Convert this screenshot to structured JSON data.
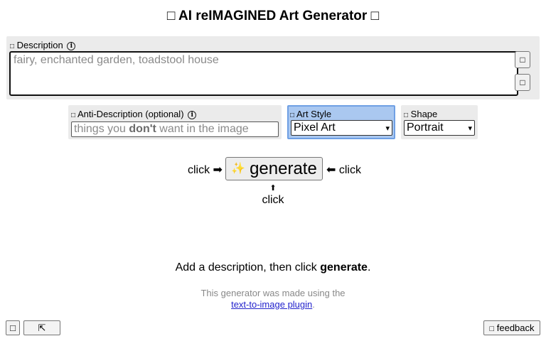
{
  "header": {
    "left_icon": "□",
    "title": "AI reIMAGINED Art Generator",
    "right_icon": "□"
  },
  "description": {
    "label_icon": "□",
    "label": "Description",
    "info_icon": "ⓘ",
    "placeholder": "fairy, enchanted garden, toadstool house",
    "value": "",
    "side_buttons": [
      "□",
      "□"
    ]
  },
  "anti_description": {
    "label_icon": "□",
    "label": "Anti-Description (optional)",
    "info_icon": "ⓘ",
    "placeholder_pre": "things you ",
    "placeholder_bold": "don't",
    "placeholder_post": " want in the image"
  },
  "art_style": {
    "label_icon": "□",
    "label": "Art Style",
    "selected": "Pixel Art"
  },
  "shape": {
    "label_icon": "□",
    "label": "Shape",
    "selected": "Portrait"
  },
  "generate": {
    "icon": "✨",
    "label": "generate",
    "left_hint": "click ➡",
    "right_hint": "⬅ click",
    "bottom_arrow": "⬆",
    "bottom_hint": "click"
  },
  "hint": {
    "pre": "Add a description, then click ",
    "bold": "generate",
    "post": "."
  },
  "credit": {
    "line1": "This generator was made using the",
    "link": "text-to-image plugin",
    "post": "."
  },
  "footer": {
    "left_button": "□",
    "up_button": "⇱",
    "feedback_icon": "□",
    "feedback_label": "feedback"
  },
  "colors": {
    "panel_bg": "#ebebeb",
    "art_style_bg": "#aac8f0",
    "link": "#2222cc"
  }
}
